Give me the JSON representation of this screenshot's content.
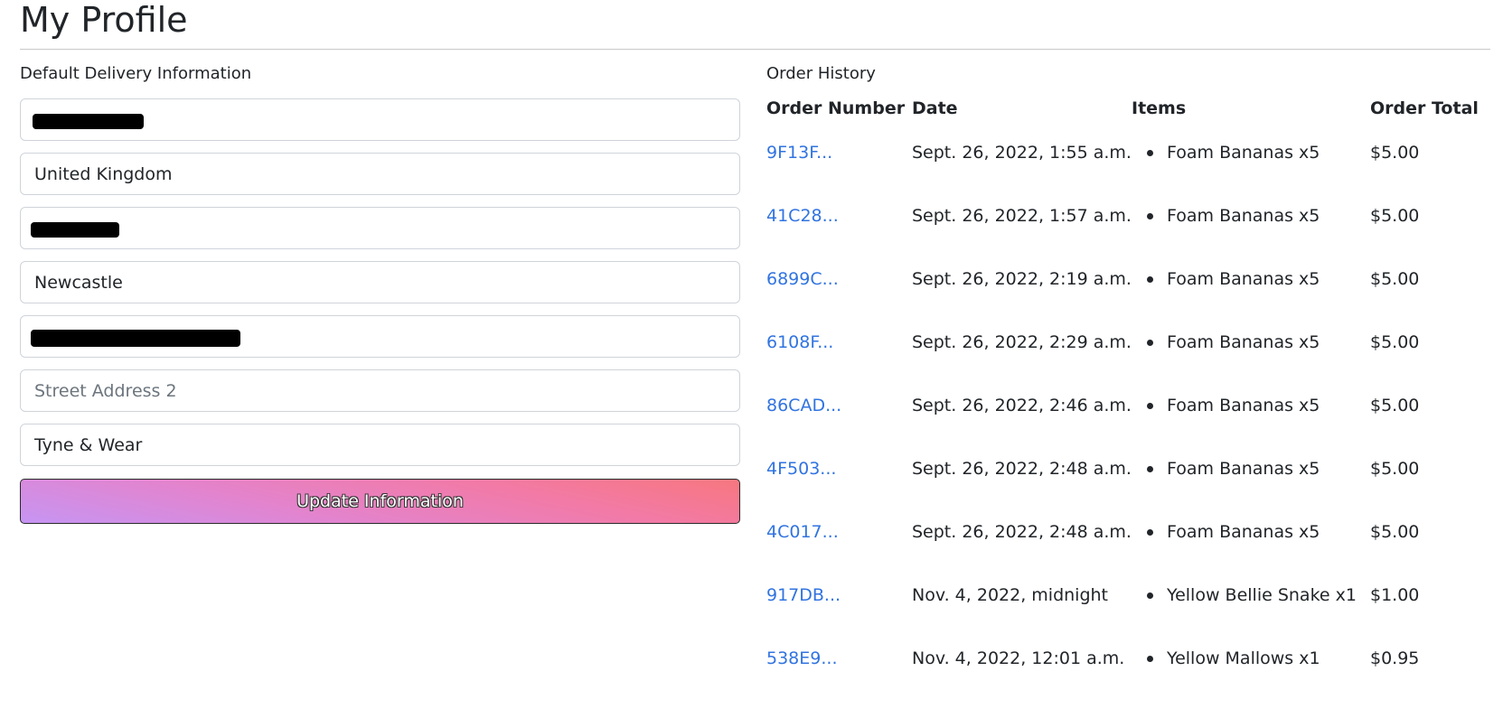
{
  "page": {
    "title": "My Profile"
  },
  "delivery": {
    "heading": "Default Delivery Information",
    "fields": [
      {
        "name": "full-name",
        "value": "",
        "placeholder": "",
        "redacted": true
      },
      {
        "name": "country",
        "value": "United Kingdom",
        "placeholder": "",
        "redacted": false
      },
      {
        "name": "postcode",
        "value": "",
        "placeholder": "",
        "redacted": true
      },
      {
        "name": "town-or-city",
        "value": "Newcastle",
        "placeholder": "",
        "redacted": false
      },
      {
        "name": "street-address-1",
        "value": "",
        "placeholder": "",
        "redacted": true
      },
      {
        "name": "street-address-2",
        "value": "",
        "placeholder": "Street Address 2",
        "redacted": false
      },
      {
        "name": "county",
        "value": "Tyne & Wear",
        "placeholder": "",
        "redacted": false
      }
    ],
    "update_label": "Update Information",
    "button_gradient": [
      "#c695f3",
      "#f7777f"
    ]
  },
  "history": {
    "heading": "Order History",
    "columns": [
      "Order Number",
      "Date",
      "Items",
      "Order Total"
    ],
    "link_color": "#3174e0",
    "orders": [
      {
        "number": "9F13F...",
        "date": "Sept. 26, 2022, 1:55 a.m.",
        "item": "Foam Bananas x5",
        "total": "$5.00"
      },
      {
        "number": "41C28...",
        "date": "Sept. 26, 2022, 1:57 a.m.",
        "item": "Foam Bananas x5",
        "total": "$5.00"
      },
      {
        "number": "6899C...",
        "date": "Sept. 26, 2022, 2:19 a.m.",
        "item": "Foam Bananas x5",
        "total": "$5.00"
      },
      {
        "number": "6108F...",
        "date": "Sept. 26, 2022, 2:29 a.m.",
        "item": "Foam Bananas x5",
        "total": "$5.00"
      },
      {
        "number": "86CAD...",
        "date": "Sept. 26, 2022, 2:46 a.m.",
        "item": "Foam Bananas x5",
        "total": "$5.00"
      },
      {
        "number": "4F503...",
        "date": "Sept. 26, 2022, 2:48 a.m.",
        "item": "Foam Bananas x5",
        "total": "$5.00"
      },
      {
        "number": "4C017...",
        "date": "Sept. 26, 2022, 2:48 a.m.",
        "item": "Foam Bananas x5",
        "total": "$5.00"
      },
      {
        "number": "917DB...",
        "date": "Nov. 4, 2022, midnight",
        "item": "Yellow Bellie Snake x1",
        "total": "$1.00"
      },
      {
        "number": "538E9...",
        "date": "Nov. 4, 2022, 12:01 a.m.",
        "item": "Yellow Mallows x1",
        "total": "$0.95"
      }
    ]
  }
}
